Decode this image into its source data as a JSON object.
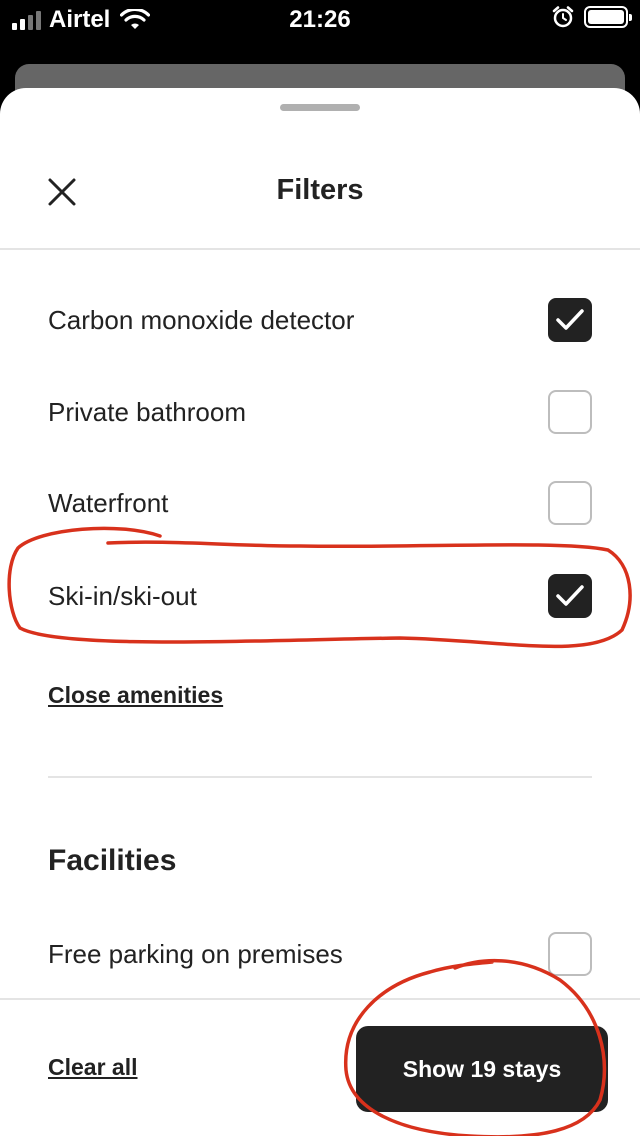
{
  "status_bar": {
    "carrier": "Airtel",
    "time": "21:26",
    "battery_level": 1.0
  },
  "header": {
    "title": "Filters"
  },
  "amenities": [
    {
      "label": "Carbon monoxide detector",
      "checked": true
    },
    {
      "label": "Private bathroom",
      "checked": false
    },
    {
      "label": "Waterfront",
      "checked": false
    },
    {
      "label": "Ski-in/ski-out",
      "checked": true
    }
  ],
  "close_amenities_link": "Close amenities",
  "facilities": {
    "heading": "Facilities",
    "items": [
      {
        "label": "Free parking on premises",
        "checked": false
      }
    ]
  },
  "footer": {
    "clear_all": "Clear all",
    "show_button": "Show 19 stays"
  },
  "colors": {
    "annotation_red": "#d8311c",
    "primary_dark": "#222222",
    "checkbox_border": "#bdbdbd"
  }
}
